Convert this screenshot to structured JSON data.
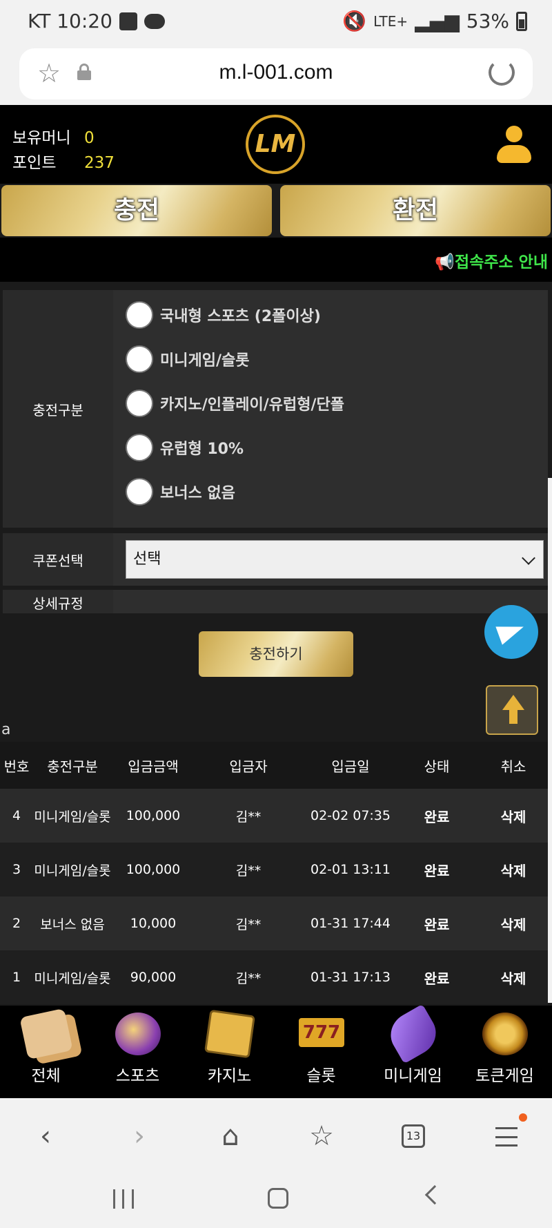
{
  "status_bar": {
    "carrier_time": "KT 10:20",
    "network": "LTE+",
    "battery": "53%"
  },
  "browser": {
    "url": "m.l-001.com",
    "tab_count": "13"
  },
  "header": {
    "money_label": "보유머니",
    "money_value": "0",
    "points_label": "포인트",
    "points_value": "237",
    "logo_text": "LM"
  },
  "actions": {
    "charge": "충전",
    "exchange": "환전"
  },
  "notice": {
    "text": "접속주소 안내"
  },
  "form": {
    "category_label": "충전구분",
    "options": [
      "국내형 스포츠 (2폴이상)",
      "미니게임/슬롯",
      "카지노/인플레이/유럽형/단폴",
      "유럽형 10%",
      "보너스 없음"
    ],
    "coupon_label": "쿠폰선택",
    "coupon_value": "선택",
    "rules_label": "상세규정",
    "submit": "충전하기"
  },
  "stray_text": "a",
  "table": {
    "headers": [
      "번호",
      "충전구분",
      "입금금액",
      "입금자",
      "입금일",
      "상태",
      "취소"
    ],
    "rows": [
      {
        "no": "4",
        "category": "미니게임/슬롯",
        "amount": "100,000",
        "depositor": "김**",
        "date": "02-02 07:35",
        "status": "완료",
        "cancel": "삭제"
      },
      {
        "no": "3",
        "category": "미니게임/슬롯",
        "amount": "100,000",
        "depositor": "김**",
        "date": "02-01 13:11",
        "status": "완료",
        "cancel": "삭제"
      },
      {
        "no": "2",
        "category": "보너스 없음",
        "amount": "10,000",
        "depositor": "김**",
        "date": "01-31 17:44",
        "status": "완료",
        "cancel": "삭제"
      },
      {
        "no": "1",
        "category": "미니게임/슬롯",
        "amount": "90,000",
        "depositor": "김**",
        "date": "01-31 17:13",
        "status": "완료",
        "cancel": "삭제"
      }
    ]
  },
  "game_nav": [
    {
      "label": "전체",
      "icon": "dice-icon"
    },
    {
      "label": "스포츠",
      "icon": "soccer-ball-icon"
    },
    {
      "label": "카지노",
      "icon": "cards-icon"
    },
    {
      "label": "슬롯",
      "icon": "slot-777-icon",
      "glyph": "777"
    },
    {
      "label": "미니게임",
      "icon": "rocket-icon"
    },
    {
      "label": "토큰게임",
      "icon": "roulette-icon"
    }
  ],
  "colors": {
    "accent_gold": "#d4b463",
    "value_yellow": "#f0e03a",
    "notice_green": "#3fe64a",
    "telegram_blue": "#2aa3de"
  }
}
